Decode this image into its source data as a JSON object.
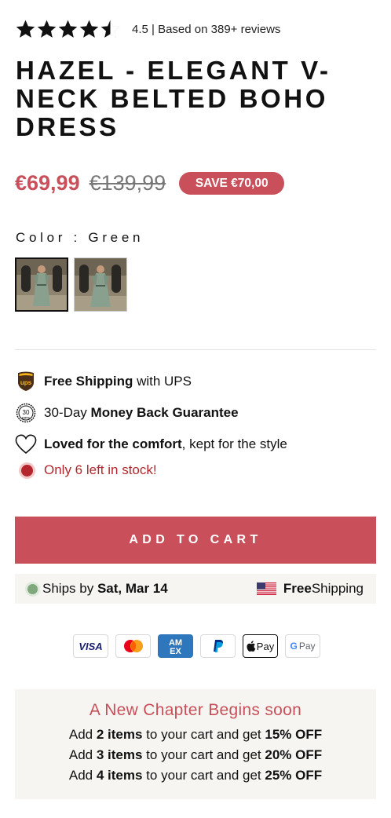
{
  "rating": {
    "value": 4.5,
    "text": "4.5 | Based on 389+ reviews"
  },
  "product": {
    "title": "HAZEL - ELEGANT V-NECK BELTED BOHO DRESS",
    "price": "€69,99",
    "compare_price": "€139,99",
    "save_badge": "SAVE €70,00"
  },
  "color": {
    "label": "Color : Green",
    "swatches": [
      {
        "name": "Green",
        "selected": true
      },
      {
        "name": "Green",
        "selected": false
      }
    ]
  },
  "features": [
    {
      "icon": "ups-icon",
      "bold": "Free Shipping",
      "rest": " with UPS"
    },
    {
      "icon": "30-days-icon",
      "pre": "30-Day ",
      "bold": "Money Back Guarantee"
    },
    {
      "icon": "heart-icon",
      "bold": "Loved for the comfort",
      "rest": ", kept for the style"
    },
    {
      "icon": "stock-dot",
      "text": "Only 6 left in stock!"
    }
  ],
  "cart": {
    "button_label": "ADD TO CART"
  },
  "shipping_bar": {
    "left_prefix": "Ships by ",
    "left_bold": "Sat, Mar 14",
    "right_bold": "Free",
    "right_rest": " Shipping"
  },
  "payment_methods": [
    "VISA",
    "Mastercard",
    "AMEX",
    "PayPal",
    "Apple Pay",
    "G Pay"
  ],
  "promo": {
    "title": "A New Chapter Begins soon",
    "lines": [
      {
        "pre": "Add ",
        "bold1": "2 items",
        "mid": " to your cart and get ",
        "bold2": "15% OFF"
      },
      {
        "pre": "Add ",
        "bold1": "3 items",
        "mid": " to your cart and get ",
        "bold2": "20% OFF"
      },
      {
        "pre": "Add ",
        "bold1": "4 items",
        "mid": " to your cart and get ",
        "bold2": "25% OFF"
      }
    ]
  },
  "colors": {
    "accent": "#c9505a",
    "stock_red": "#b3262d",
    "panel_bg": "#f6f5f1",
    "ships_dot": "#7fa87d"
  }
}
